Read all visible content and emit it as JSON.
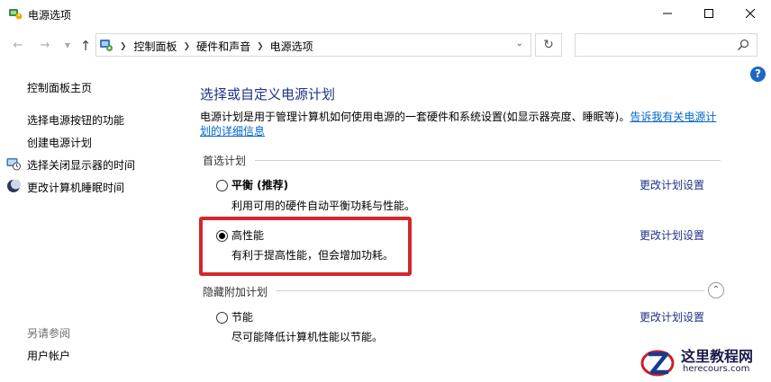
{
  "window": {
    "title": "电源选项"
  },
  "address": {
    "crumbs": [
      "控制面板",
      "硬件和声音",
      "电源选项"
    ],
    "search_placeholder": ""
  },
  "sidebar": {
    "home": "控制面板主页",
    "links": [
      {
        "label": "选择电源按钮的功能",
        "icon": null
      },
      {
        "label": "创建电源计划",
        "icon": null
      },
      {
        "label": "选择关闭显示器的时间",
        "icon": "monitor-clock-icon"
      },
      {
        "label": "更改计算机睡眠时间",
        "icon": "moon-icon"
      }
    ],
    "see_also": "另请参阅",
    "user_accounts": "用户帐户"
  },
  "main": {
    "title": "选择或自定义电源计划",
    "description": "电源计划是用于管理计算机如何使用电源的一套硬件和系统设置(如显示器亮度、睡眠等)。",
    "description_link": "告诉我有关电源计划的详细信息",
    "preferred_heading": "首选计划",
    "hidden_heading": "隐藏附加计划",
    "plans": [
      {
        "name": "平衡 (推荐)",
        "desc": "利用可用的硬件自动平衡功耗与性能。",
        "selected": false,
        "link": "更改计划设置"
      },
      {
        "name": "高性能",
        "desc": "有利于提高性能，但会增加功耗。",
        "selected": true,
        "link": "更改计划设置"
      },
      {
        "name": "节能",
        "desc": "尽可能降低计算机性能以节能。",
        "selected": false,
        "link": "更改计划设置"
      }
    ],
    "highlight_color": "#d4262d",
    "link_color": "#1e3287"
  },
  "watermark": {
    "title": "这里教程网",
    "subtitle": "herecours.com"
  }
}
